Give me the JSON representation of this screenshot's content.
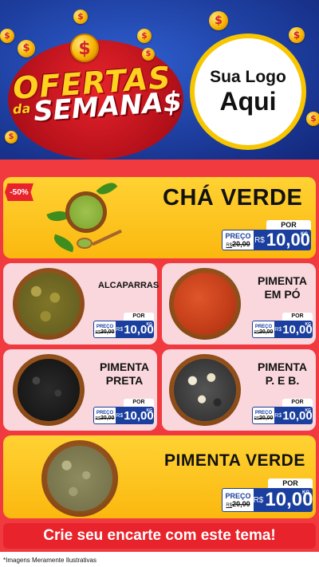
{
  "header": {
    "title_line1": "OFERTAS",
    "title_da": "da",
    "title_line2": "SEMANA$",
    "logo_line1": "Sua Logo",
    "logo_line2": "Aqui",
    "coin_symbol": "$"
  },
  "products": [
    {
      "name": "CHÁ VERDE",
      "badge": "-50%",
      "por": "POR",
      "preco": "PREÇO",
      "old_currency": "R$",
      "old_price": "20,00",
      "currency": "R$",
      "price": "10,00",
      "unit": "KG"
    },
    {
      "name": "ALCAPARRAS",
      "por": "POR",
      "preco": "PREÇO",
      "old_currency": "R$",
      "old_price": "20,00",
      "currency": "R$",
      "price": "10,00",
      "unit": "KG"
    },
    {
      "name_line1": "PIMENTA",
      "name_line2": "EM PÓ",
      "por": "POR",
      "preco": "PREÇO",
      "old_currency": "R$",
      "old_price": "20,00",
      "currency": "R$",
      "price": "10,00",
      "unit": "KG"
    },
    {
      "name_line1": "PIMENTA",
      "name_line2": "PRETA",
      "por": "POR",
      "preco": "PREÇO",
      "old_currency": "R$",
      "old_price": "20,00",
      "currency": "R$",
      "price": "10,00",
      "unit": "KG"
    },
    {
      "name_line1": "PIMENTA",
      "name_line2": "P. E B.",
      "por": "POR",
      "preco": "PREÇO",
      "old_currency": "R$",
      "old_price": "20,00",
      "currency": "R$",
      "price": "10,00",
      "unit": "KG"
    },
    {
      "name": "PIMENTA VERDE",
      "por": "POR",
      "preco": "PREÇO",
      "old_currency": "R$",
      "old_price": "20,00",
      "currency": "R$",
      "price": "10,00",
      "unit": "KG"
    }
  ],
  "cta": "Crie seu encarte com este tema!",
  "footer_note": "*Imagens Meramente Ilustrativas",
  "colors": {
    "accent_red": "#e8232b",
    "brand_blue": "#1a3f9e",
    "yellow": "#fbb80f",
    "pink": "#f9d7dc"
  }
}
